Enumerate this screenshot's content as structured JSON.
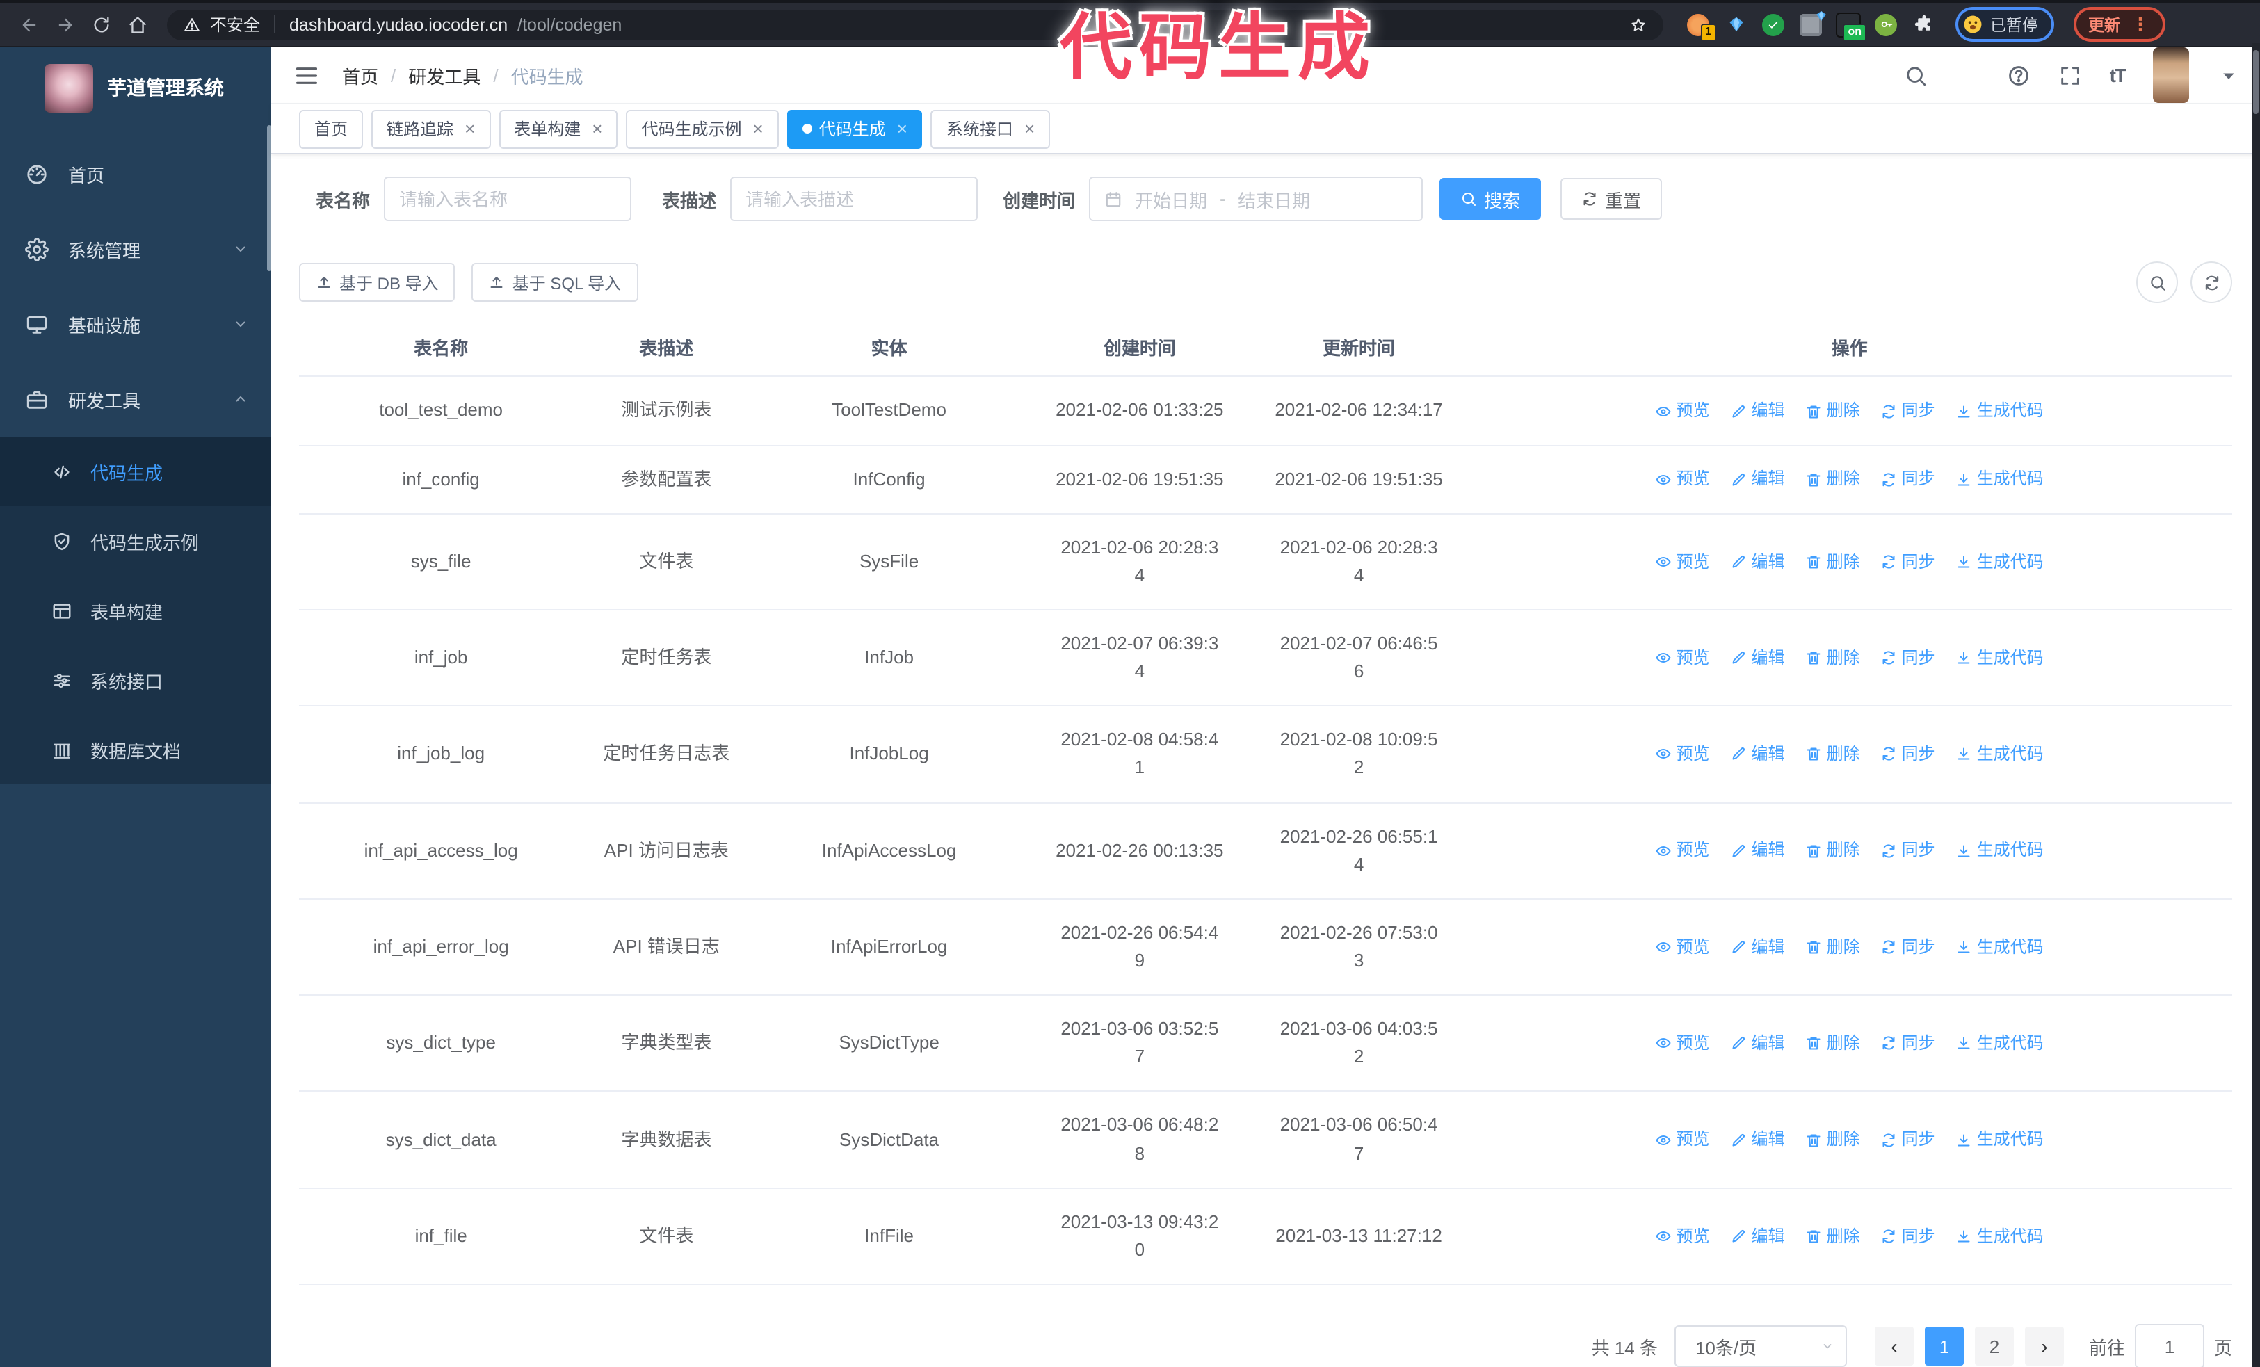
{
  "colors": {
    "accent": "#409eff",
    "active_tab": "#1d9bf5",
    "annotation": "#f2455f",
    "sidebar_bg": "#24405a",
    "submenu_bg": "#1b3248"
  },
  "annotation": {
    "text": "代码生成"
  },
  "browser": {
    "security_label": "不安全",
    "url_host": "dashboard.yudao.iocoder.cn",
    "url_path": "/tool/codegen",
    "extension_badge": "1",
    "extension_on_label": "on",
    "profile_status": "已暂停",
    "update_label": "更新"
  },
  "sidebar": {
    "title": "芋道管理系统",
    "menu": [
      {
        "label": "首页",
        "icon": "dashboard-icon",
        "chevron": null,
        "active": false
      },
      {
        "label": "系统管理",
        "icon": "gear-icon",
        "chevron": "down",
        "active": false
      },
      {
        "label": "基础设施",
        "icon": "monitor-icon",
        "chevron": "down",
        "active": false
      },
      {
        "label": "研发工具",
        "icon": "toolbox-icon",
        "chevron": "up",
        "active": false
      }
    ],
    "submenu": [
      {
        "label": "代码生成",
        "icon": "code-icon",
        "active": true
      },
      {
        "label": "代码生成示例",
        "icon": "shield-icon",
        "active": false
      },
      {
        "label": "表单构建",
        "icon": "form-icon",
        "active": false
      },
      {
        "label": "系统接口",
        "icon": "sliders-icon",
        "active": false
      },
      {
        "label": "数据库文档",
        "icon": "database-icon",
        "active": false
      }
    ]
  },
  "breadcrumb": [
    "首页",
    "研发工具",
    "代码生成"
  ],
  "tabs": [
    {
      "label": "首页",
      "closable": false,
      "active": false
    },
    {
      "label": "链路追踪",
      "closable": true,
      "active": false
    },
    {
      "label": "表单构建",
      "closable": true,
      "active": false
    },
    {
      "label": "代码生成示例",
      "closable": true,
      "active": false
    },
    {
      "label": "代码生成",
      "closable": true,
      "active": true
    },
    {
      "label": "系统接口",
      "closable": true,
      "active": false
    }
  ],
  "filters": {
    "name_label": "表名称",
    "name_placeholder": "请输入表名称",
    "desc_label": "表描述",
    "desc_placeholder": "请输入表描述",
    "time_label": "创建时间",
    "start_placeholder": "开始日期",
    "separator": "-",
    "end_placeholder": "结束日期",
    "search_label": "搜索",
    "reset_label": "重置"
  },
  "import": {
    "db": "基于 DB 导入",
    "sql": "基于 SQL 导入"
  },
  "table": {
    "columns": [
      "表名称",
      "表描述",
      "实体",
      "创建时间",
      "更新时间",
      "操作"
    ],
    "action_labels": [
      "预览",
      "编辑",
      "删除",
      "同步",
      "生成代码"
    ],
    "rows": [
      {
        "name": "tool_test_demo",
        "description": "测试示例表",
        "entity": "ToolTestDemo",
        "created": "2021-02-06 01:33:25",
        "updated": "2021-02-06 12:34:17"
      },
      {
        "name": "inf_config",
        "description": "参数配置表",
        "entity": "InfConfig",
        "created": "2021-02-06 19:51:35",
        "updated": "2021-02-06 19:51:35"
      },
      {
        "name": "sys_file",
        "description": "文件表",
        "entity": "SysFile",
        "created": "2021-02-06 20:28:3\n4",
        "updated": "2021-02-06 20:28:3\n4"
      },
      {
        "name": "inf_job",
        "description": "定时任务表",
        "entity": "InfJob",
        "created": "2021-02-07 06:39:3\n4",
        "updated": "2021-02-07 06:46:5\n6"
      },
      {
        "name": "inf_job_log",
        "description": "定时任务日志表",
        "entity": "InfJobLog",
        "created": "2021-02-08 04:58:4\n1",
        "updated": "2021-02-08 10:09:5\n2"
      },
      {
        "name": "inf_api_access_log",
        "description": "API 访问日志表",
        "entity": "InfApiAccessLog",
        "created": "2021-02-26 00:13:35",
        "updated": "2021-02-26 06:55:1\n4"
      },
      {
        "name": "inf_api_error_log",
        "description": "API 错误日志",
        "entity": "InfApiErrorLog",
        "created": "2021-02-26 06:54:4\n9",
        "updated": "2021-02-26 07:53:0\n3"
      },
      {
        "name": "sys_dict_type",
        "description": "字典类型表",
        "entity": "SysDictType",
        "created": "2021-03-06 03:52:5\n7",
        "updated": "2021-03-06 04:03:5\n2"
      },
      {
        "name": "sys_dict_data",
        "description": "字典数据表",
        "entity": "SysDictData",
        "created": "2021-03-06 06:48:2\n8",
        "updated": "2021-03-06 06:50:4\n7"
      },
      {
        "name": "inf_file",
        "description": "文件表",
        "entity": "InfFile",
        "created": "2021-03-13 09:43:2\n0",
        "updated": "2021-03-13 11:27:12"
      }
    ]
  },
  "pagination": {
    "total": "共 14 条",
    "page_size": "10条/页",
    "pages": [
      "1",
      "2"
    ],
    "active_page": "1",
    "goto_label": "前往",
    "goto_value": "1",
    "goto_unit": "页"
  }
}
